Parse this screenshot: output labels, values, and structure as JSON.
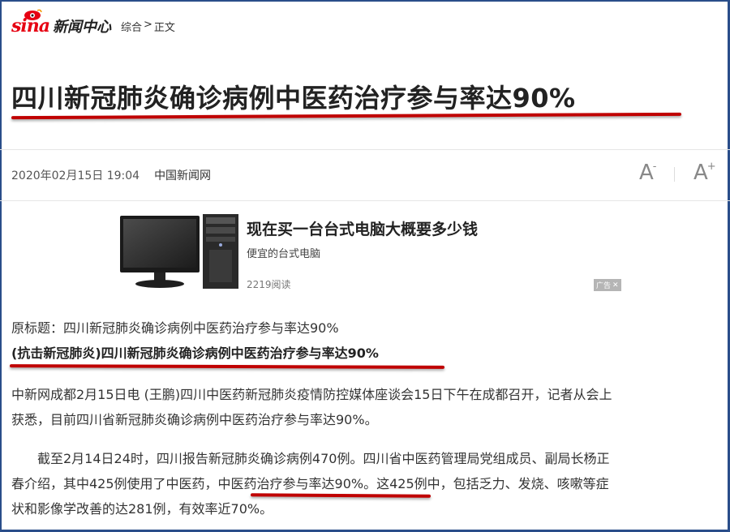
{
  "header": {
    "logo_text": "sina",
    "logo_sub": "新闻中心",
    "breadcrumb": [
      "综合",
      ">",
      "正文"
    ]
  },
  "article": {
    "title": "四川新冠肺炎确诊病例中医药治疗参与率达90%",
    "date": "2020年02月15日 19:04",
    "source": "中国新闻网",
    "font_smaller": "A",
    "font_smaller_mark": "-",
    "font_larger": "A",
    "font_larger_mark": "+",
    "original_title": "原标题：四川新冠肺炎确诊病例中医药治疗参与率达90%",
    "bold_title": "(抗击新冠肺炎)四川新冠肺炎确诊病例中医药治疗参与率达90%",
    "para1_line1": "中新网成都2月15日电 (王鹏)四川中医药新冠肺炎疫情防控媒体座谈会15日下午在成都召开，记者从会上",
    "para1_line2": "获悉，目前四川省新冠肺炎确诊病例中医药治疗参与率达90%。",
    "para2_line1": "截至2月14日24时，四川报告新冠肺炎确诊病例470例。四川省中医药管理局党组成员、副局长杨正",
    "para2_line2_a": "春介绍，其中425例使用了中医药，",
    "para2_line2_b": "中医药治疗参与率达90%",
    "para2_line2_c": "。这425例中，包括乏力、发烧、咳嗽等症",
    "para2_line3": "状和影像学改善的达281例，有效率近70%。"
  },
  "ad": {
    "title": "现在买一台台式电脑大概要多少钱",
    "subtitle": "便宜的台式电脑",
    "reads": "2219阅读",
    "badge": "广告"
  },
  "colors": {
    "brand_red": "#e60012",
    "annotation_red": "#c00000",
    "frame_blue": "#2a4e8a"
  }
}
